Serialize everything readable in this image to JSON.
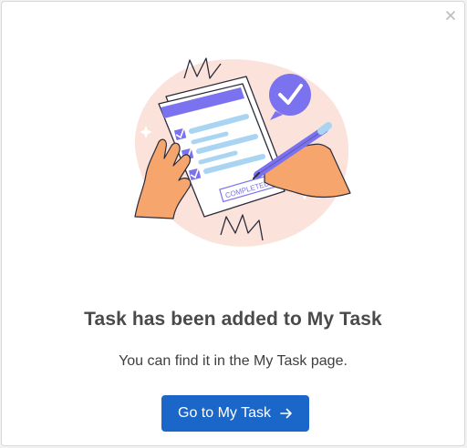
{
  "dialog": {
    "title": "Task has been added to My Task",
    "message": "You can find it in the My Task page.",
    "button_label": "Go to My Task",
    "illustration_stamp_text": "COMPLETED"
  },
  "colors": {
    "primary": "#1b66c9",
    "title_text": "#4a4a4a",
    "illustration_purple": "#7b72f0",
    "illustration_peach": "#fbe3dc",
    "hand_orange": "#f6a56c"
  },
  "icons": {
    "close": "close-icon",
    "arrow": "arrow-right-icon",
    "illustration": "task-completed-illustration"
  }
}
